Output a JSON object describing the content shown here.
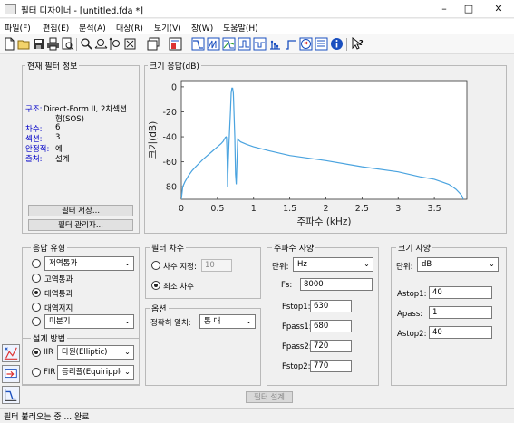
{
  "window": {
    "title": "필터 디자이너 - [untitled.fda *]",
    "minimize": "–",
    "maximize": "□",
    "close": "✕"
  },
  "menu": [
    "파일(F)",
    "편집(E)",
    "분석(A)",
    "대상(R)",
    "보기(V)",
    "창(W)",
    "도움말(H)"
  ],
  "toolbar": {
    "icons": [
      "new-icon",
      "open-icon",
      "save-icon",
      "print-icon",
      "print-preview-icon",
      "zoom-in-icon",
      "zoom-x-icon",
      "zoom-y-icon",
      "full-view-icon",
      "new-window-icon",
      "filter-specs-icon",
      "magnitude-response-icon",
      "phase-response-icon",
      "magnitude-phase-icon",
      "group-delay-icon",
      "phase-delay-icon",
      "impulse-response-icon",
      "step-response-icon",
      "pole-zero-icon",
      "coefficients-icon",
      "info-icon",
      "whats-this-icon"
    ]
  },
  "filter_info": {
    "title": "현재 필터 정보",
    "rows": [
      {
        "key": "구조:",
        "value": "Direct-Form II, 2차섹션"
      },
      {
        "key": "",
        "value": "형(SOS)"
      },
      {
        "key": "차수:",
        "value": "6"
      },
      {
        "key": "섹션:",
        "value": "3"
      },
      {
        "key": "안정적:",
        "value": "예"
      },
      {
        "key": "출처:",
        "value": "설계"
      }
    ],
    "save_button": "필터 저장...",
    "manager_button": "필터 관리자..."
  },
  "magnitude_panel": {
    "title": "크기 응답(dB)"
  },
  "chart_data": {
    "type": "line",
    "xlabel": "주파수 (kHz)",
    "ylabel": "크기(dB)",
    "xlim": [
      0,
      3.95
    ],
    "ylim": [
      -90,
      5
    ],
    "xticks": [
      "0",
      "0.5",
      "1",
      "1.5",
      "2",
      "2.5",
      "3",
      "3.5"
    ],
    "xtick_values": [
      0,
      0.5,
      1,
      1.5,
      2,
      2.5,
      3,
      3.5
    ],
    "yticks": [
      "0",
      "-20",
      "-40",
      "-60",
      "-80"
    ],
    "ytick_values": [
      0,
      -20,
      -40,
      -60,
      -80
    ],
    "grid": false,
    "series": [
      {
        "color": "#4aa3df",
        "x": [
          0.0,
          0.02,
          0.05,
          0.1,
          0.15,
          0.2,
          0.25,
          0.3,
          0.35,
          0.4,
          0.45,
          0.5,
          0.55,
          0.58,
          0.6,
          0.61,
          0.62,
          0.625,
          0.63,
          0.635,
          0.64,
          0.65,
          0.66,
          0.68,
          0.69,
          0.7,
          0.71,
          0.72,
          0.74,
          0.75,
          0.76,
          0.77,
          0.78,
          0.79,
          0.8,
          0.82,
          0.9,
          1.0,
          1.2,
          1.5,
          2.0,
          2.5,
          3.0,
          3.3,
          3.5,
          3.6,
          3.7,
          3.75,
          3.8,
          3.85,
          3.88,
          3.9
        ],
        "y": [
          -90,
          -80,
          -76,
          -71,
          -67,
          -64,
          -61,
          -58,
          -55.5,
          -53,
          -50.5,
          -48,
          -45.5,
          -43.5,
          -41.5,
          -40.5,
          -40,
          -40.5,
          -48,
          -60,
          -80,
          -60,
          -45,
          -20,
          -5,
          -1,
          -1,
          -5,
          -40,
          -70,
          -78,
          -60,
          -42,
          -42.5,
          -43,
          -44,
          -46,
          -48,
          -51,
          -55,
          -59,
          -64,
          -68,
          -72,
          -74,
          -76,
          -78,
          -80,
          -82,
          -85,
          -87,
          -90
        ]
      }
    ]
  },
  "response_type": {
    "title": "응답 유형",
    "options": [
      "저역통과",
      "고역통과",
      "대역통과",
      "대역저지",
      "미분기"
    ],
    "selected_index": 2,
    "lowpass_select": "저역통과",
    "diff_select": "미분기"
  },
  "design_method": {
    "title": "설계 방법",
    "iir_label": "IIR",
    "iir_value": "타원(Elliptic)",
    "fir_label": "FIR",
    "fir_value": "등리플(Equiripple)"
  },
  "filter_order": {
    "title": "필터 차수",
    "specify_label": "차수 지정:",
    "specify_value": "10",
    "minimum_label": "최소 차수"
  },
  "options": {
    "title": "옵션",
    "match_label": "정확히 일치:",
    "match_value": "통 대"
  },
  "freq_specs": {
    "title": "주파수 사양",
    "units_label": "단위:",
    "units_value": "Hz",
    "fields": [
      {
        "label": "Fs:",
        "value": "8000"
      },
      {
        "label": "Fstop1:",
        "value": "630"
      },
      {
        "label": "Fpass1:",
        "value": "680"
      },
      {
        "label": "Fpass2:",
        "value": "720"
      },
      {
        "label": "Fstop2:",
        "value": "770"
      }
    ]
  },
  "mag_specs": {
    "title": "크기 사양",
    "units_label": "단위:",
    "units_value": "dB",
    "fields": [
      {
        "label": "Astop1:",
        "value": "40"
      },
      {
        "label": "Apass:",
        "value": "1"
      },
      {
        "label": "Astop2:",
        "value": "40"
      }
    ]
  },
  "design_button": "필터 설계",
  "status": "필터 불러오는 중 ... 완료"
}
